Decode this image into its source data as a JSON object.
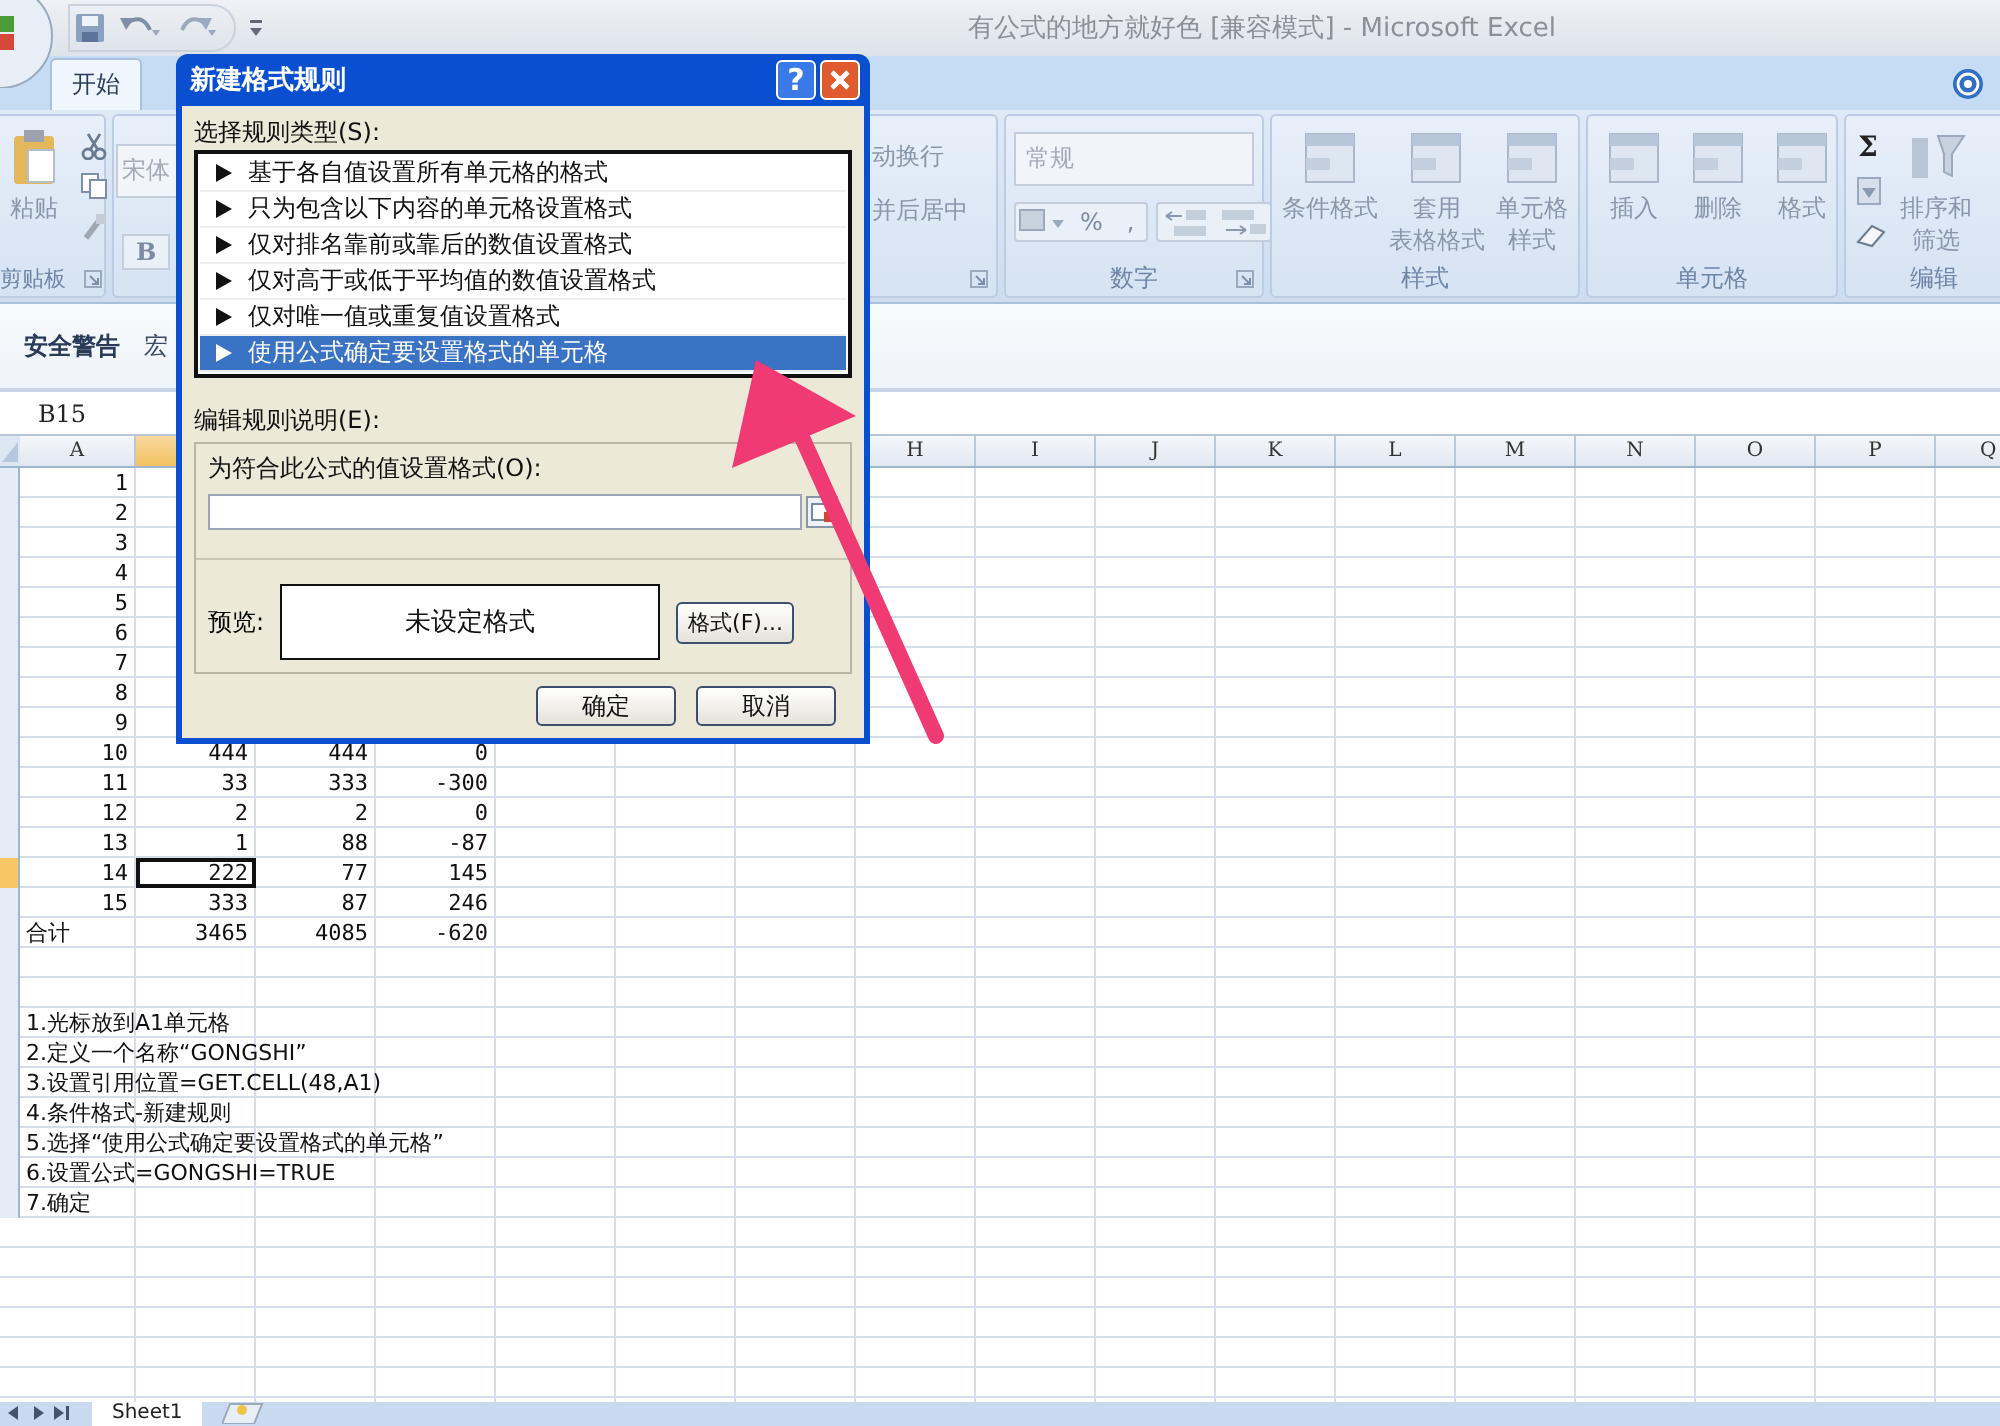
{
  "window": {
    "title": "有公式的地方就好色 [兼容模式] - Microsoft Excel"
  },
  "tabs": [
    {
      "label": "开始",
      "selected": true
    }
  ],
  "ribbon": {
    "groups": [
      {
        "kind": "clipboard",
        "label": "剪贴板",
        "items": [
          "粘贴"
        ]
      },
      {
        "kind": "font",
        "items": [
          "宋体",
          "B"
        ]
      },
      {
        "kind": "alignment",
        "items": [
          "动换行",
          "并后居中"
        ]
      },
      {
        "kind": "number",
        "label": "数字",
        "items": [
          "常规",
          "%",
          ","
        ]
      },
      {
        "kind": "styles",
        "label": "样式",
        "items": [
          [
            "条件格式"
          ],
          [
            "套用",
            "表格格式"
          ],
          [
            "单元格",
            "样式"
          ]
        ]
      },
      {
        "kind": "cells",
        "label": "单元格",
        "items": [
          [
            "插入"
          ],
          [
            "删除"
          ],
          [
            "格式"
          ]
        ]
      },
      {
        "kind": "editing",
        "label": "编辑",
        "items": [
          "Σ",
          [
            "排序和",
            "筛选"
          ]
        ]
      }
    ]
  },
  "security_bar": {
    "items": [
      "安全警告",
      "宏"
    ]
  },
  "name_box": "B15",
  "sheet": {
    "columns": [
      {
        "label": "A",
        "selected": false
      },
      {
        "selected": true
      },
      {},
      {},
      {},
      {},
      {},
      {
        "label": "H",
        "selected": false
      },
      {
        "label": "I",
        "selected": false
      },
      {
        "label": "J",
        "selected": false
      },
      {
        "label": "K",
        "selected": false
      },
      {
        "label": "L",
        "selected": false
      },
      {
        "label": "M",
        "selected": false
      },
      {
        "label": "N",
        "selected": false
      },
      {
        "label": "O",
        "selected": false
      },
      {
        "label": "P",
        "selected": false
      },
      {
        "label": "Q",
        "selected": false
      }
    ],
    "rows": [
      {
        "selected": false,
        "cells": [
          {
            "text": "1",
            "kind": "number",
            "selected": false
          }
        ]
      },
      {
        "selected": false,
        "cells": [
          {
            "text": "2",
            "kind": "number",
            "selected": false
          }
        ]
      },
      {
        "selected": false,
        "cells": [
          {
            "text": "3",
            "kind": "number",
            "selected": false
          }
        ]
      },
      {
        "selected": false,
        "cells": [
          {
            "text": "4",
            "kind": "number",
            "selected": false
          }
        ]
      },
      {
        "selected": false,
        "cells": [
          {
            "text": "5",
            "kind": "number",
            "selected": false
          }
        ]
      },
      {
        "selected": false,
        "cells": [
          {
            "text": "6",
            "kind": "number",
            "selected": false
          }
        ]
      },
      {
        "selected": false,
        "cells": [
          {
            "text": "7",
            "kind": "number",
            "selected": false
          }
        ]
      },
      {
        "selected": false,
        "cells": [
          {
            "text": "8",
            "kind": "number",
            "selected": false
          }
        ]
      },
      {
        "selected": false,
        "cells": [
          {
            "text": "9",
            "kind": "number",
            "selected": false
          }
        ]
      },
      {
        "selected": false,
        "cells": [
          {
            "text": "10",
            "kind": "number",
            "selected": false
          },
          {
            "text": "444",
            "kind": "number",
            "selected": false
          },
          {
            "text": "444",
            "kind": "number",
            "selected": false
          },
          {
            "text": "0",
            "kind": "number",
            "selected": false
          }
        ]
      },
      {
        "selected": false,
        "cells": [
          {
            "text": "11",
            "kind": "number",
            "selected": false
          },
          {
            "text": "33",
            "kind": "number",
            "selected": false
          },
          {
            "text": "333",
            "kind": "number",
            "selected": false
          },
          {
            "text": "-300",
            "kind": "number",
            "selected": false
          }
        ]
      },
      {
        "selected": false,
        "cells": [
          {
            "text": "12",
            "kind": "number",
            "selected": false
          },
          {
            "text": "2",
            "kind": "number",
            "selected": false
          },
          {
            "text": "2",
            "kind": "number",
            "selected": false
          },
          {
            "text": "0",
            "kind": "number",
            "selected": false
          }
        ]
      },
      {
        "selected": false,
        "cells": [
          {
            "text": "13",
            "kind": "number",
            "selected": false
          },
          {
            "text": "1",
            "kind": "number",
            "selected": false
          },
          {
            "text": "88",
            "kind": "number",
            "selected": false
          },
          {
            "text": "-87",
            "kind": "number",
            "selected": false
          }
        ]
      },
      {
        "selected": true,
        "cells": [
          {
            "text": "14",
            "kind": "number",
            "selected": false
          },
          {
            "text": "222",
            "kind": "number",
            "selected": true
          },
          {
            "text": "77",
            "kind": "number",
            "selected": false
          },
          {
            "text": "145",
            "kind": "number",
            "selected": false
          }
        ]
      },
      {
        "selected": false,
        "cells": [
          {
            "text": "15",
            "kind": "number",
            "selected": false
          },
          {
            "text": "333",
            "kind": "number",
            "selected": false
          },
          {
            "text": "87",
            "kind": "number",
            "selected": false
          },
          {
            "text": "246",
            "kind": "number",
            "selected": false
          }
        ]
      },
      {
        "selected": false,
        "cells": [
          {
            "text": "合计",
            "kind": "text",
            "selected": false
          },
          {
            "text": "3465",
            "kind": "number",
            "selected": false
          },
          {
            "text": "4085",
            "kind": "number",
            "selected": false
          },
          {
            "text": "-620",
            "kind": "number",
            "selected": false
          }
        ]
      },
      {
        "selected": false
      },
      {
        "selected": false
      },
      {
        "selected": false,
        "cells": [
          {
            "text": "1.光标放到A1单元格",
            "kind": "text",
            "selected": false
          }
        ]
      },
      {
        "selected": false,
        "cells": [
          {
            "text": "2.定义一个名称“GONGSHI”",
            "kind": "text",
            "selected": false
          }
        ]
      },
      {
        "selected": false,
        "cells": [
          {
            "text": "3.设置引用位置=GET.CELL(48,A1)",
            "kind": "text",
            "selected": false
          }
        ]
      },
      {
        "selected": false,
        "cells": [
          {
            "text": "4.条件格式-新建规则",
            "kind": "text",
            "selected": false
          }
        ]
      },
      {
        "selected": false,
        "cells": [
          {
            "text": "5.选择“使用公式确定要设置格式的单元格”",
            "kind": "text",
            "selected": false
          }
        ]
      },
      {
        "selected": false,
        "cells": [
          {
            "text": "6.设置公式=GONGSHI=TRUE",
            "kind": "text",
            "selected": false
          }
        ]
      },
      {
        "selected": false,
        "cells": [
          {
            "text": "7.确定",
            "kind": "text",
            "selected": false
          }
        ]
      }
    ]
  },
  "sheet_tabs": [
    {
      "label": "Sheet1",
      "selected": true
    }
  ],
  "dialog": {
    "title": "新建格式规则",
    "help_button": "?",
    "rule_type_label": "选择规则类型(S):",
    "rule_types": [
      {
        "label": "基于各自值设置所有单元格的格式",
        "selected": false
      },
      {
        "label": "只为包含以下内容的单元格设置格式",
        "selected": false
      },
      {
        "label": "仅对排名靠前或靠后的数值设置格式",
        "selected": false
      },
      {
        "label": "仅对高于或低于平均值的数值设置格式",
        "selected": false
      },
      {
        "label": "仅对唯一值或重复值设置格式",
        "selected": false
      },
      {
        "label": "使用公式确定要设置格式的单元格",
        "selected": true
      }
    ],
    "description_label": "编辑规则说明(E):",
    "formula_label": "为符合此公式的值设置格式(O):",
    "preview_label": "预览:",
    "preview_text": "未设定格式",
    "format_button": "格式(F)...",
    "buttons": [
      "确定",
      "取消"
    ]
  }
}
